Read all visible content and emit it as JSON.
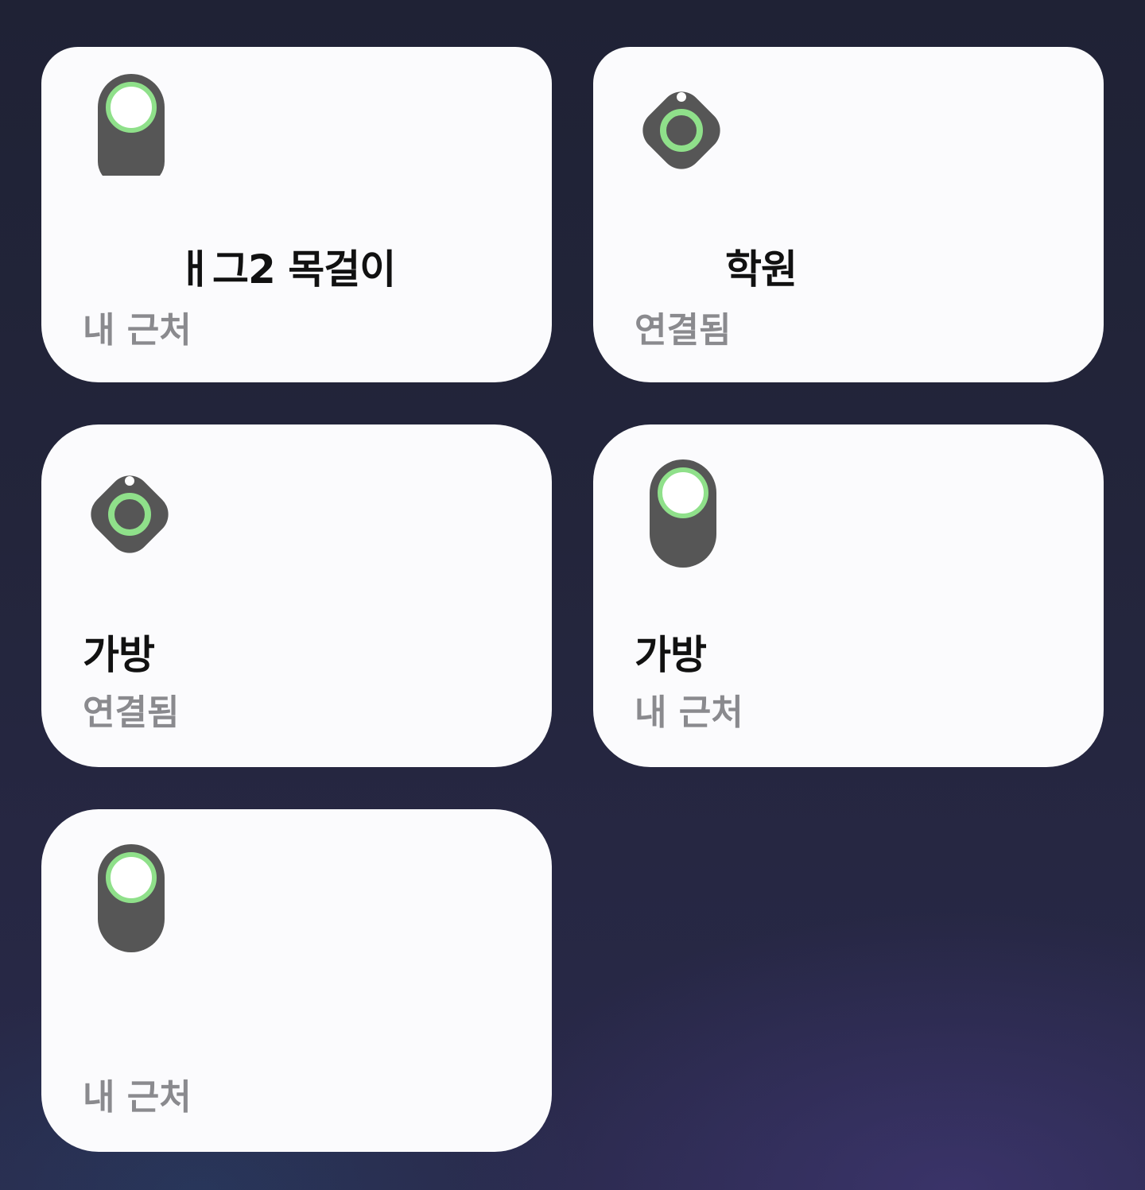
{
  "colors": {
    "card_background": "#fbfbfd",
    "device_body": "#565656",
    "device_ring": "#8fe08a",
    "name_text": "#111111",
    "status_text": "#8a8a8e"
  },
  "devices": [
    {
      "name": "ㅐ그2 목걸이",
      "status": "내 근처",
      "icon": "tag-pill-icon"
    },
    {
      "name": "학원",
      "status": "연결됨",
      "icon": "tag-diamond-icon"
    },
    {
      "name": "가방",
      "status": "연결됨",
      "icon": "tag-diamond-icon"
    },
    {
      "name": "가방",
      "status": "내 근처",
      "icon": "tag-pill-icon"
    },
    {
      "name": "",
      "status": "내 근처",
      "icon": "tag-pill-icon"
    }
  ]
}
